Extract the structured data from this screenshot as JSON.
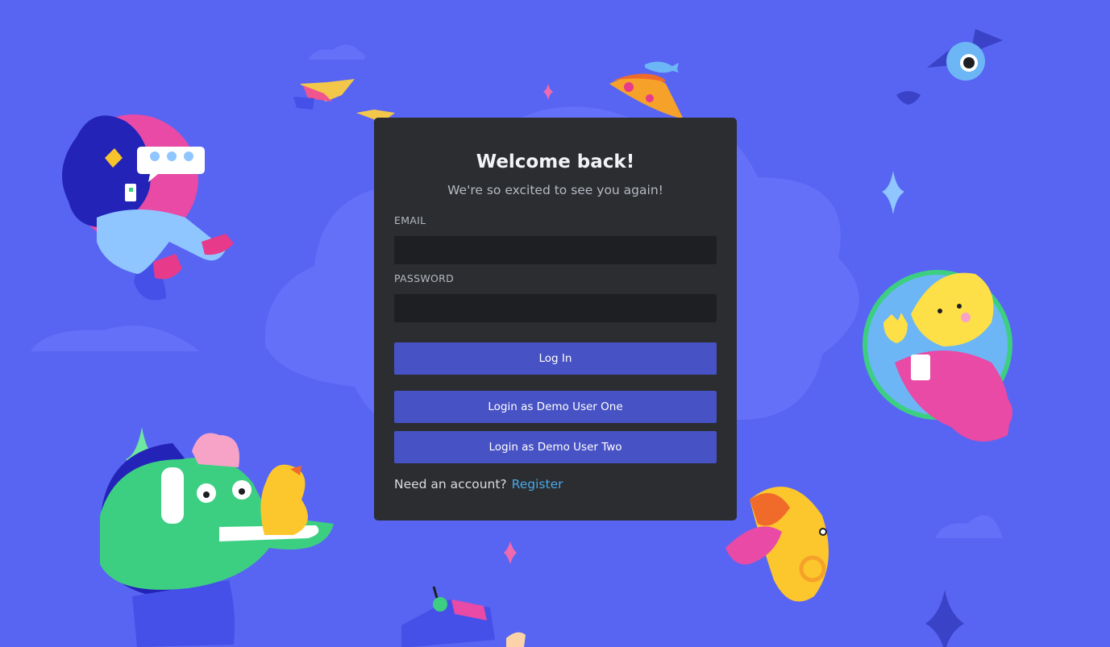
{
  "login": {
    "title": "Welcome back!",
    "subtitle": "We're so excited to see you again!",
    "email_label": "EMAIL",
    "email_value": "",
    "password_label": "PASSWORD",
    "password_value": "",
    "login_button": "Log In",
    "demo_one_button": "Login as Demo User One",
    "demo_two_button": "Login as Demo User Two",
    "need_account": "Need an account?",
    "register_link": "Register"
  },
  "colors": {
    "background": "#5865f2",
    "card": "#2b2d31",
    "input": "#1e1f22",
    "button": "#4752c4",
    "link": "#4aa8e8"
  },
  "illustrations": [
    "girl-with-phone-illustration",
    "crocodile-with-headphones-illustration",
    "yellow-character-with-coffee-illustration",
    "trumpet-creature-illustration",
    "bat-eyeball-creature-illustration",
    "pizza-slice-illustration",
    "flying-book-illustration",
    "game-console-illustration"
  ]
}
